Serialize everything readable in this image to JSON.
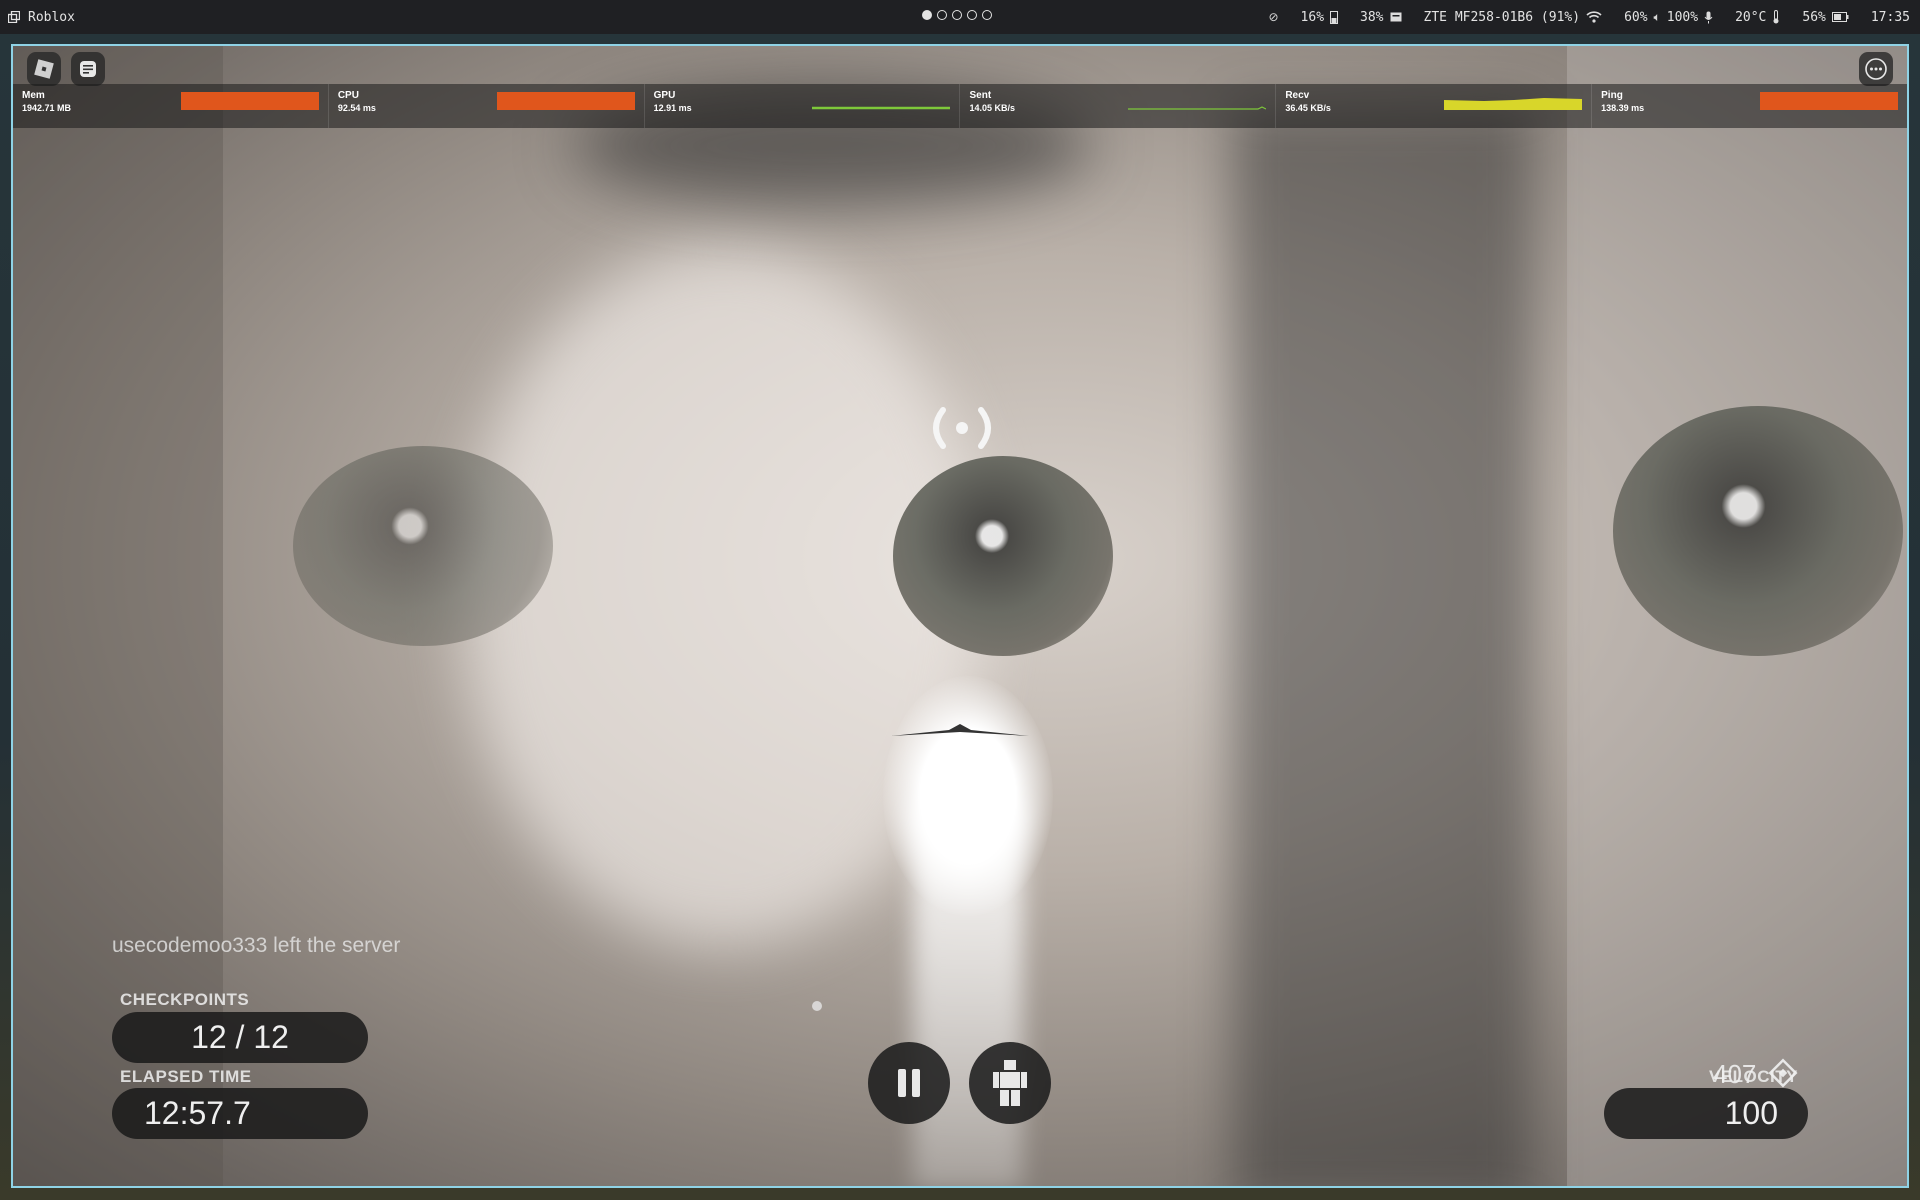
{
  "topbar": {
    "app_title": "Roblox",
    "workspaces": [
      {
        "active": true
      },
      {
        "active": false
      },
      {
        "active": false
      },
      {
        "active": false
      },
      {
        "active": false
      }
    ],
    "status": {
      "cpu_gauge": "16%",
      "memory": "38%",
      "network_name": "ZTE MF258-01B6 (91%)",
      "brightness": "60%",
      "volume": "100%",
      "temperature": "20°C",
      "battery": "56%",
      "clock": "17:35"
    }
  },
  "window": {
    "stats": [
      {
        "name": "Mem",
        "value": "1942.71 MB",
        "graph": "bar",
        "color": "#e0561c"
      },
      {
        "name": "CPU",
        "value": "92.54 ms",
        "graph": "bar",
        "color": "#e0561c"
      },
      {
        "name": "GPU",
        "value": "12.91 ms",
        "graph": "line",
        "color": "#7ec83a"
      },
      {
        "name": "Sent",
        "value": "14.05 KB/s",
        "graph": "line",
        "color": "#7ec83a"
      },
      {
        "name": "Recv",
        "value": "36.45 KB/s",
        "graph": "area",
        "color": "#d8d62a"
      },
      {
        "name": "Ping",
        "value": "138.39 ms",
        "graph": "bar",
        "color": "#e0561c"
      }
    ],
    "hud": {
      "chat_message": "usecodemoo333 left the server",
      "checkpoints_label": "CHECKPOINTS",
      "checkpoints_value": "12 / 12",
      "elapsed_label": "ELAPSED TIME",
      "elapsed_value": "12:57.7",
      "velocity_label": "VELOCITY",
      "velocity_value": "100",
      "score_value": "407"
    },
    "icons": {
      "roblox_menu": "roblox-logo-icon",
      "chat": "chat-icon",
      "more": "more-options-icon",
      "pause": "pause-icon",
      "character": "avatar-icon",
      "broadcast": "signal-icon",
      "diamond": "diamond-target-icon"
    }
  }
}
